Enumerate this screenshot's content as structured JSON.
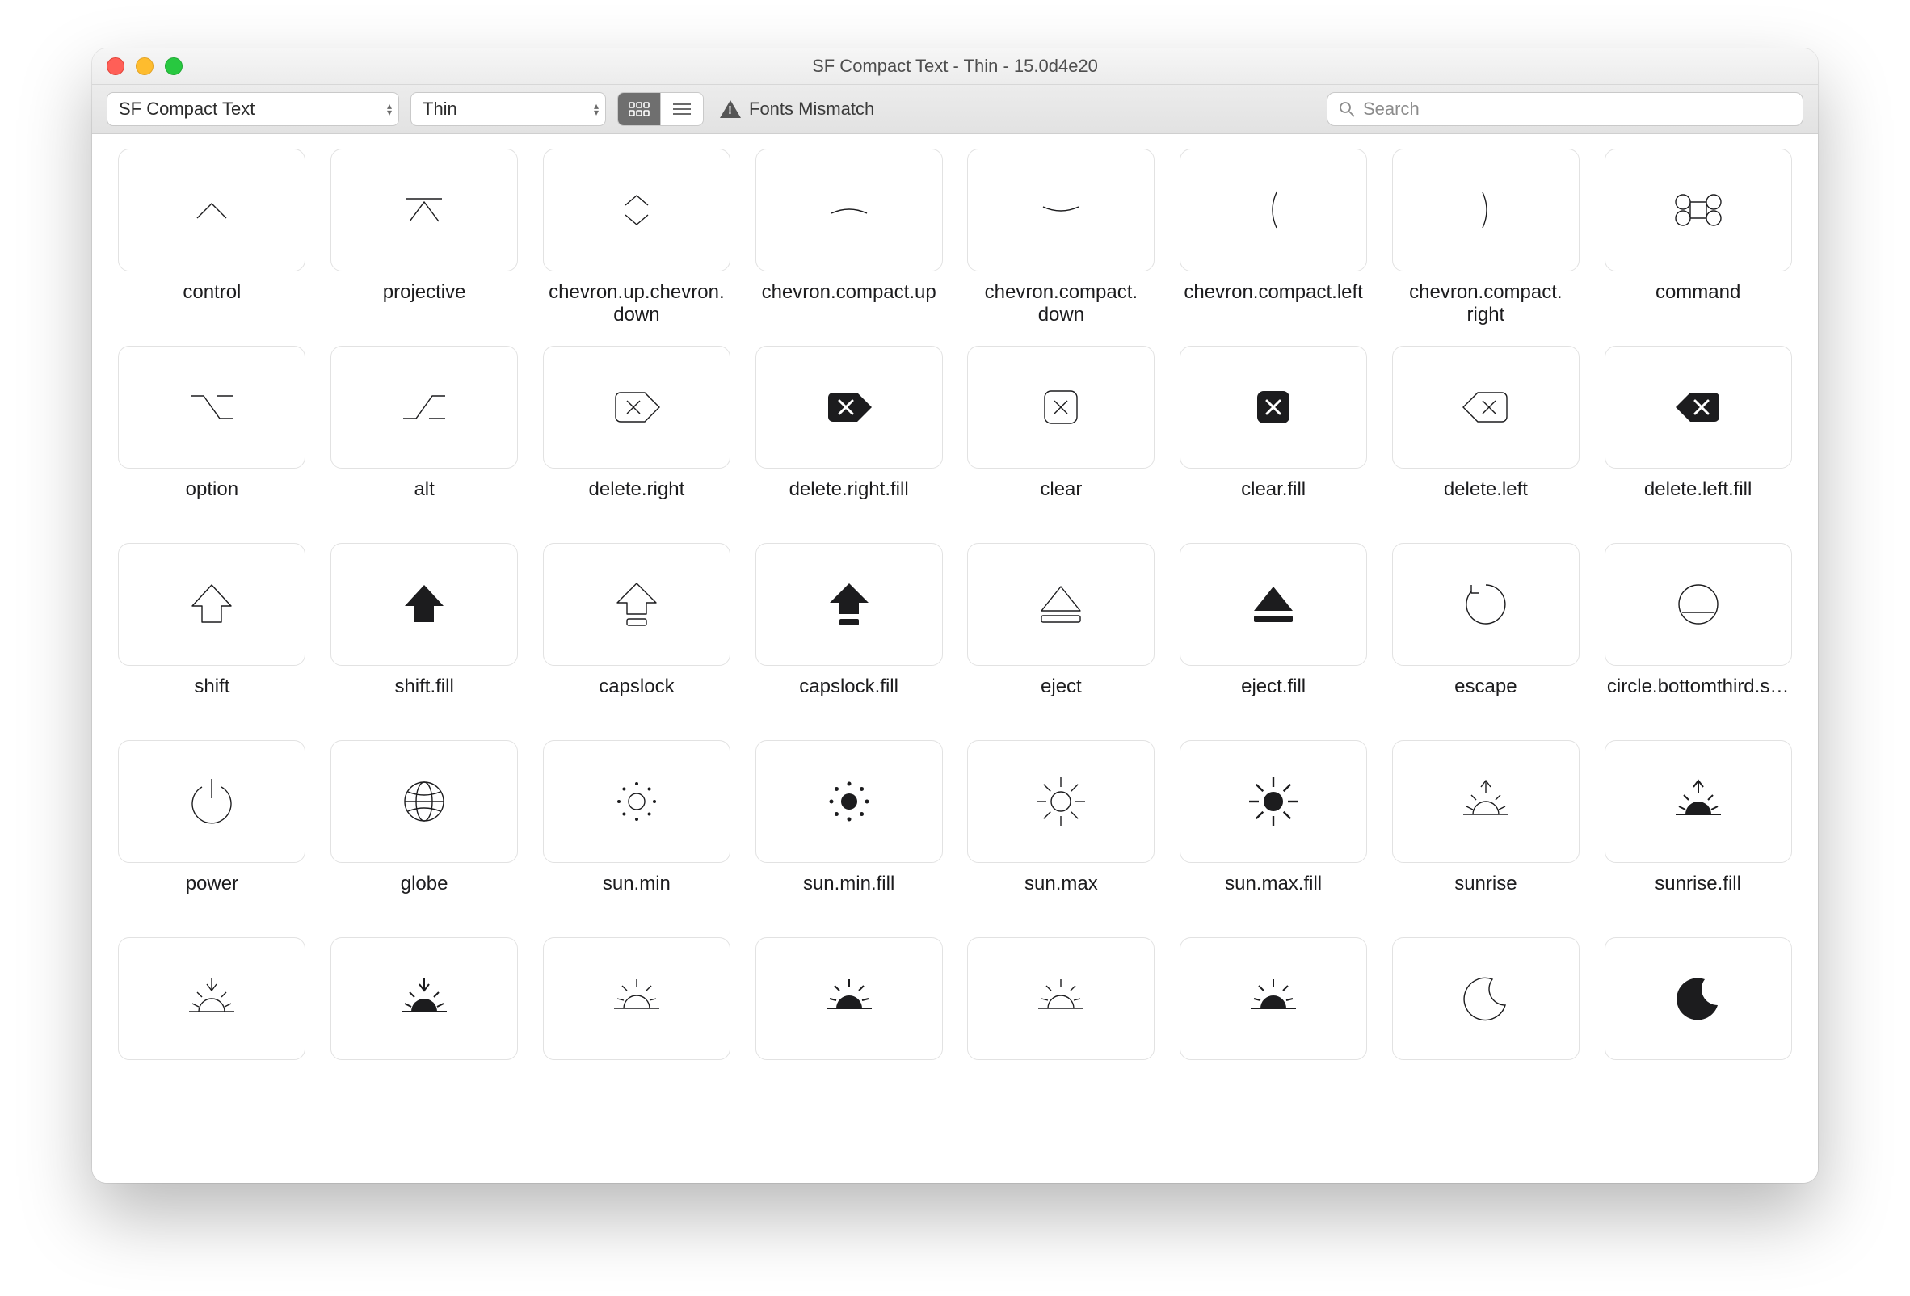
{
  "window": {
    "title": "SF Compact Text - Thin - 15.0d4e20"
  },
  "toolbar": {
    "font_family": "SF Compact Text",
    "font_weight": "Thin",
    "view_mode": "grid",
    "warning": "Fonts Mismatch",
    "search_placeholder": "Search"
  },
  "icon_stroke_light": "#1c1c1e",
  "icon_fill_dark": "#1c1c1e",
  "symbols": [
    {
      "name": "control",
      "glyph": "control"
    },
    {
      "name": "projective",
      "glyph": "projective"
    },
    {
      "name": "chevron.up.chevron.down",
      "glyph": "chevron-up-down"
    },
    {
      "name": "chevron.compact.up",
      "glyph": "chevron-compact-up"
    },
    {
      "name": "chevron.compact.down",
      "glyph": "chevron-compact-down"
    },
    {
      "name": "chevron.compact.left",
      "glyph": "chevron-compact-left"
    },
    {
      "name": "chevron.compact.right",
      "glyph": "chevron-compact-right"
    },
    {
      "name": "command",
      "glyph": "command"
    },
    {
      "name": "option",
      "glyph": "option"
    },
    {
      "name": "alt",
      "glyph": "alt"
    },
    {
      "name": "delete.right",
      "glyph": "delete-right"
    },
    {
      "name": "delete.right.fill",
      "glyph": "delete-right-fill"
    },
    {
      "name": "clear",
      "glyph": "clear"
    },
    {
      "name": "clear.fill",
      "glyph": "clear-fill"
    },
    {
      "name": "delete.left",
      "glyph": "delete-left"
    },
    {
      "name": "delete.left.fill",
      "glyph": "delete-left-fill"
    },
    {
      "name": "shift",
      "glyph": "shift"
    },
    {
      "name": "shift.fill",
      "glyph": "shift-fill"
    },
    {
      "name": "capslock",
      "glyph": "capslock"
    },
    {
      "name": "capslock.fill",
      "glyph": "capslock-fill"
    },
    {
      "name": "eject",
      "glyph": "eject"
    },
    {
      "name": "eject.fill",
      "glyph": "eject-fill"
    },
    {
      "name": "escape",
      "glyph": "escape"
    },
    {
      "name": "circle.bottomthird.s…",
      "glyph": "circle-bottomthird"
    },
    {
      "name": "power",
      "glyph": "power"
    },
    {
      "name": "globe",
      "glyph": "globe"
    },
    {
      "name": "sun.min",
      "glyph": "sun-min"
    },
    {
      "name": "sun.min.fill",
      "glyph": "sun-min-fill"
    },
    {
      "name": "sun.max",
      "glyph": "sun-max"
    },
    {
      "name": "sun.max.fill",
      "glyph": "sun-max-fill"
    },
    {
      "name": "sunrise",
      "glyph": "sunrise"
    },
    {
      "name": "sunrise.fill",
      "glyph": "sunrise-fill"
    },
    {
      "name": "",
      "glyph": "sunset"
    },
    {
      "name": "",
      "glyph": "sunset-fill"
    },
    {
      "name": "",
      "glyph": "sun-horizon"
    },
    {
      "name": "",
      "glyph": "sun-horizon-fill"
    },
    {
      "name": "",
      "glyph": "sun-horizon"
    },
    {
      "name": "",
      "glyph": "sun-horizon-fill"
    },
    {
      "name": "",
      "glyph": "moon"
    },
    {
      "name": "",
      "glyph": "moon-fill"
    }
  ]
}
